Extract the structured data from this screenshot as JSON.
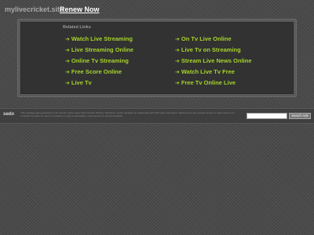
{
  "header": {
    "domain": "mylivecricket.site",
    "renew_label": "Renew Now"
  },
  "related": {
    "title": "Related Links",
    "links": [
      {
        "label": "Watch Live Streaming"
      },
      {
        "label": "Live Streaming Online"
      },
      {
        "label": "Online Tv Streaming"
      },
      {
        "label": "Free Score Online"
      },
      {
        "label": "Live Tv"
      },
      {
        "label": "On Tv Live Online"
      },
      {
        "label": "Live Tv on Streaming"
      },
      {
        "label": "Stream Live News Online"
      },
      {
        "label": "Watch Live Tv Free"
      },
      {
        "label": "Free Tv Online Live"
      }
    ],
    "arrow_glyph": "➔"
  },
  "footer": {
    "logo": "sedo",
    "disclaimer": "This webpage was generated by the domain owner using Sedo Domain Parking. Disclaimer: Sedo maintains no relationship with third party advertisers. Reference to any specific service or trade mark is not controlled by Sedo nor does it constitute or imply its association, endorsement or recommendation.",
    "search_placeholder": "",
    "search_button": "Search Ads"
  },
  "colors": {
    "link": "#a5d22a",
    "background": "#4b4b4b",
    "panel": "#323232"
  }
}
